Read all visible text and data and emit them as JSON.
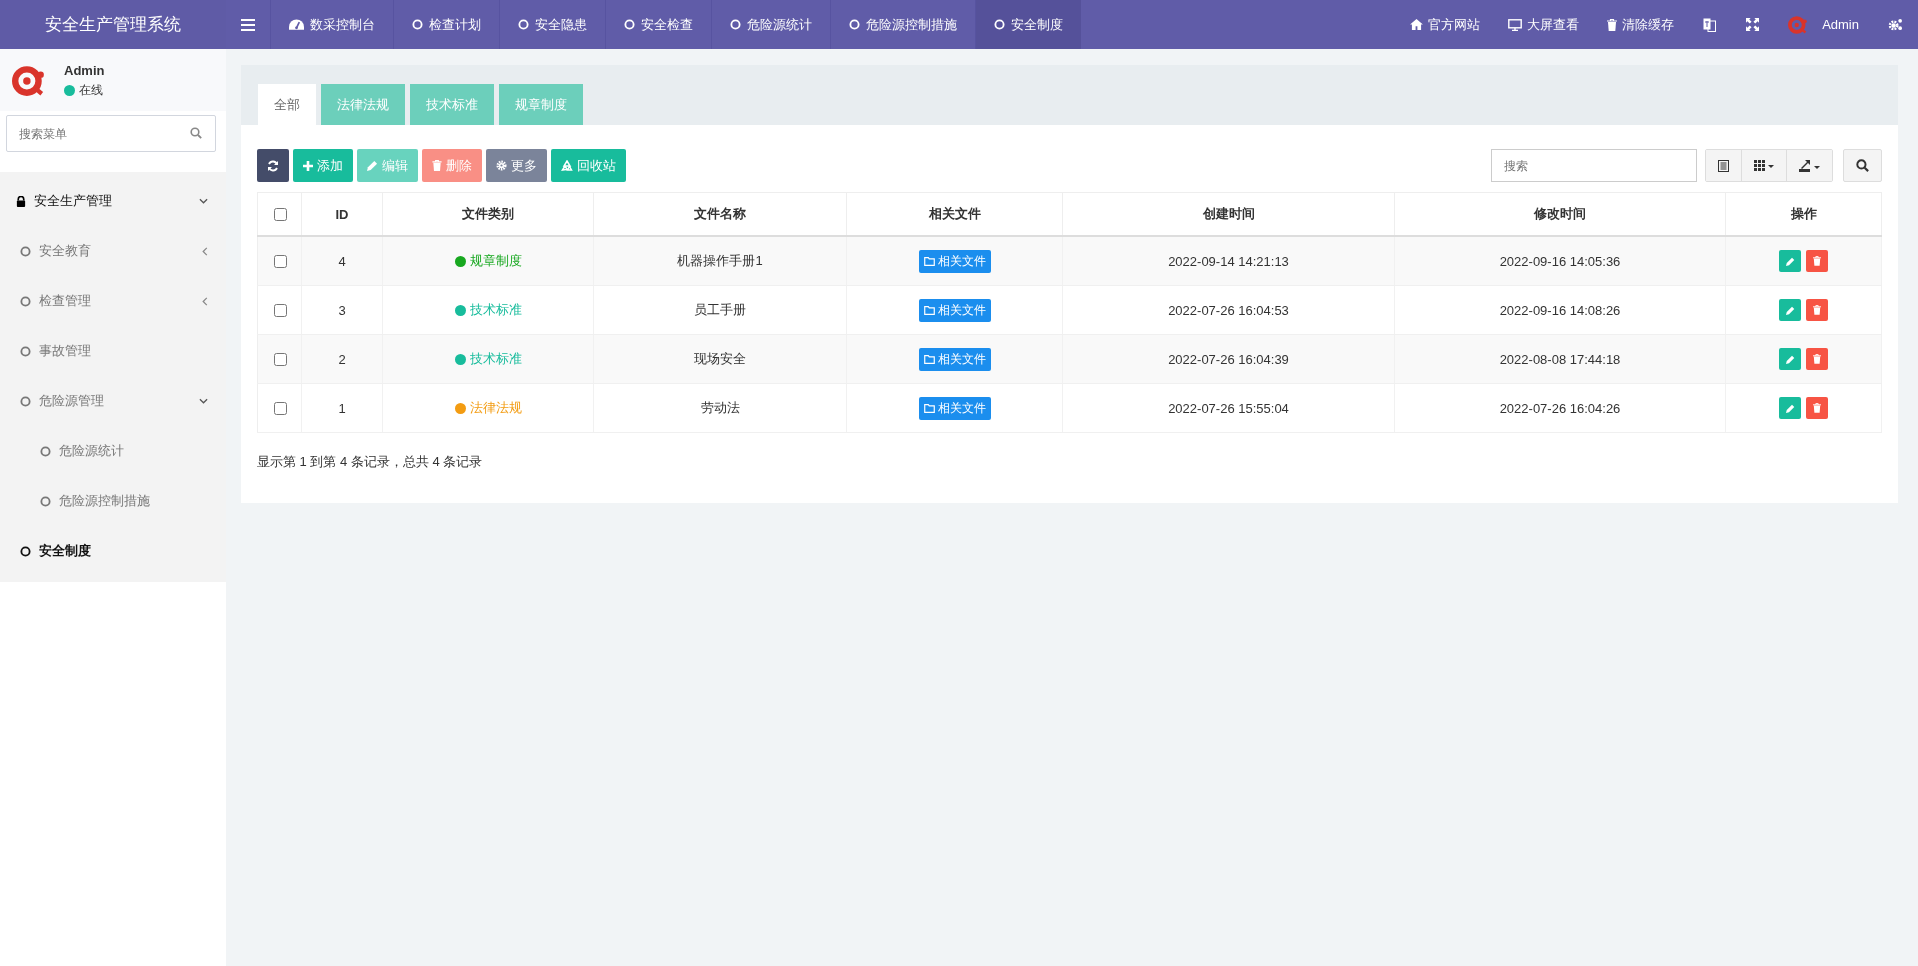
{
  "app": {
    "title": "安全生产管理系统"
  },
  "topnav": [
    {
      "label": "数采控制台",
      "kind": "dashboard",
      "selected": false
    },
    {
      "label": "检查计划",
      "kind": "page",
      "selected": false
    },
    {
      "label": "安全隐患",
      "kind": "page",
      "selected": false
    },
    {
      "label": "安全检查",
      "kind": "page",
      "selected": false
    },
    {
      "label": "危险源统计",
      "kind": "page",
      "selected": false
    },
    {
      "label": "危险源控制措施",
      "kind": "page",
      "selected": false
    },
    {
      "label": "安全制度",
      "kind": "page",
      "selected": true
    }
  ],
  "toplinks": [
    {
      "label": "官方网站",
      "kind": "home"
    },
    {
      "label": "大屏查看",
      "kind": "monitor"
    },
    {
      "label": "清除缓存",
      "kind": "trash"
    }
  ],
  "header_user": {
    "name": "Admin"
  },
  "user": {
    "name": "Admin",
    "status": "在线"
  },
  "sidebar": {
    "search_placeholder": "搜索菜单",
    "items": [
      {
        "label": "安全生产管理",
        "expanded": true,
        "selected": false,
        "children": [
          {
            "label": "安全教育",
            "expanded": false,
            "selected": false
          },
          {
            "label": "检查管理",
            "expanded": false,
            "selected": false
          },
          {
            "label": "事故管理",
            "selected": false
          },
          {
            "label": "危险源管理",
            "expanded": true,
            "selected": false,
            "children": [
              {
                "label": "危险源统计",
                "selected": false
              },
              {
                "label": "危险源控制措施",
                "selected": false
              }
            ]
          },
          {
            "label": "安全制度",
            "selected": true
          }
        ]
      }
    ]
  },
  "tabs": [
    {
      "label": "全部",
      "selected": true
    },
    {
      "label": "法律法规",
      "selected": false
    },
    {
      "label": "技术标准",
      "selected": false
    },
    {
      "label": "规章制度",
      "selected": false
    }
  ],
  "toolbar": [
    {
      "label": "添加",
      "kind": "add",
      "disabled": false
    },
    {
      "label": "编辑",
      "kind": "edit",
      "disabled": true
    },
    {
      "label": "删除",
      "kind": "delete",
      "disabled": true
    },
    {
      "label": "更多",
      "kind": "more",
      "disabled": false
    },
    {
      "label": "回收站",
      "kind": "recycle",
      "disabled": false
    }
  ],
  "search": {
    "placeholder": "搜索"
  },
  "table": {
    "select_all": {
      "checked": false
    },
    "columns": [
      "ID",
      "文件类别",
      "文件名称",
      "相关文件",
      "创建时间",
      "修改时间",
      "操作"
    ],
    "rows": [
      {
        "checked": false,
        "id": "4",
        "category": "规章制度",
        "color": "#18a820",
        "name": "机器操作手册1",
        "file": "相关文件",
        "created": "2022-09-14 14:21:13",
        "modified": "2022-09-16 14:05:36"
      },
      {
        "checked": false,
        "id": "3",
        "category": "技术标准",
        "color": "#18bc9c",
        "name": "员工手册",
        "file": "相关文件",
        "created": "2022-07-26 16:04:53",
        "modified": "2022-09-16 14:08:26"
      },
      {
        "checked": false,
        "id": "2",
        "category": "技术标准",
        "color": "#18bc9c",
        "name": "现场安全",
        "file": "相关文件",
        "created": "2022-07-26 16:04:39",
        "modified": "2022-08-08 17:44:18"
      },
      {
        "checked": false,
        "id": "1",
        "category": "法律法规",
        "color": "#f39c12",
        "name": "劳动法",
        "file": "相关文件",
        "created": "2022-07-26 15:55:04",
        "modified": "2022-07-26 16:04:26"
      }
    ]
  },
  "pagination": {
    "summary": "显示第 1 到第 4 条记录，总共 4 条记录"
  }
}
